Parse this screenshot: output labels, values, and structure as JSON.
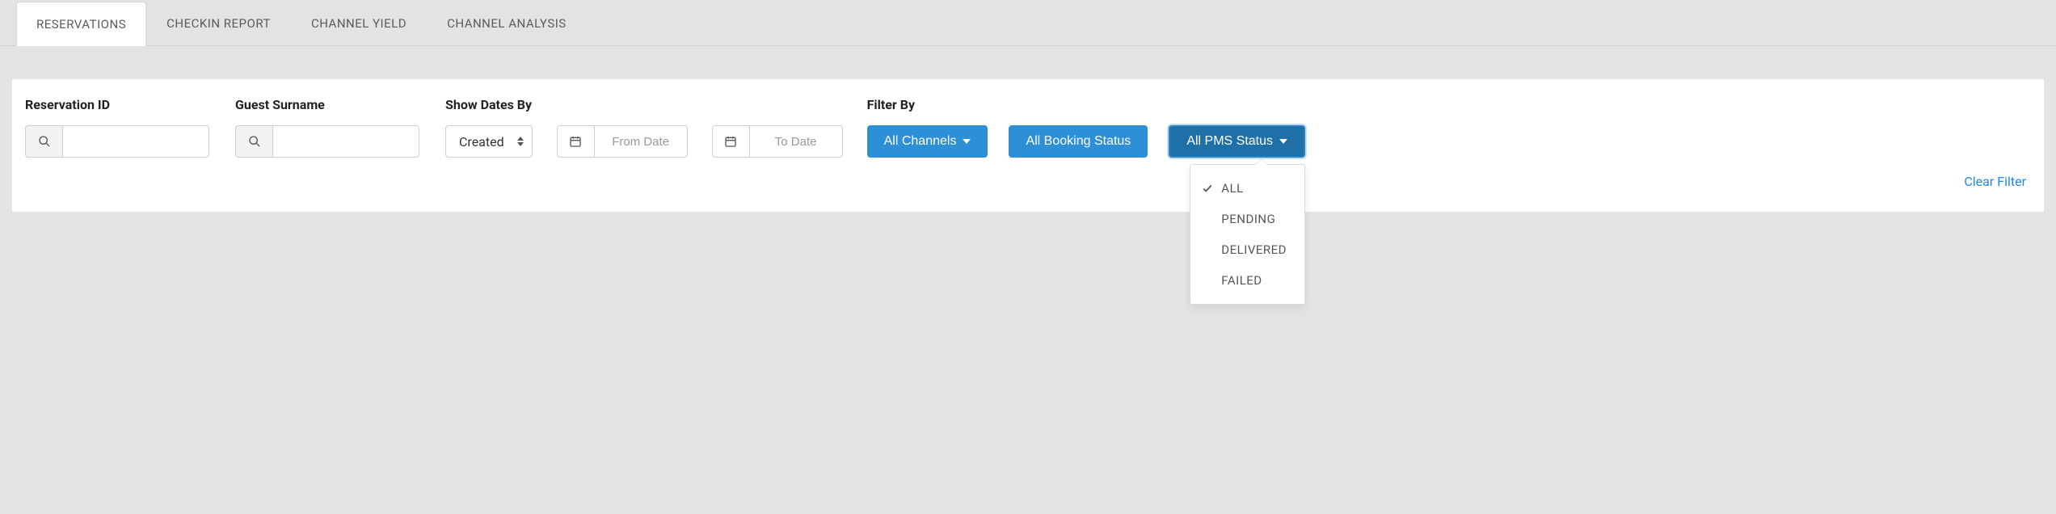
{
  "tabs": [
    {
      "label": "RESERVATIONS",
      "active": true
    },
    {
      "label": "CHECKIN REPORT",
      "active": false
    },
    {
      "label": "CHANNEL YIELD",
      "active": false
    },
    {
      "label": "CHANNEL ANALYSIS",
      "active": false
    }
  ],
  "filters": {
    "reservation_id": {
      "label": "Reservation ID",
      "value": ""
    },
    "guest_surname": {
      "label": "Guest Surname",
      "value": ""
    },
    "show_dates_by": {
      "label": "Show Dates By",
      "selected": "Created"
    },
    "from_date": {
      "placeholder": "From Date",
      "value": ""
    },
    "to_date": {
      "placeholder": "To Date",
      "value": ""
    },
    "filter_by_label": "Filter By",
    "channels_button": "All Channels",
    "booking_status_button": "All Booking Status",
    "pms_status_button": "All PMS Status",
    "pms_status_options": [
      {
        "label": "ALL",
        "selected": true
      },
      {
        "label": "PENDING",
        "selected": false
      },
      {
        "label": "DELIVERED",
        "selected": false
      },
      {
        "label": "FAILED",
        "selected": false
      }
    ],
    "clear_filters": "Clear Filter"
  },
  "colors": {
    "primary": "#2d8fd5",
    "primary_active": "#1f6fa8",
    "link": "#1e88e5",
    "page_bg": "#e3e3e3",
    "panel_bg": "#ffffff",
    "border": "#cfcfcf"
  }
}
